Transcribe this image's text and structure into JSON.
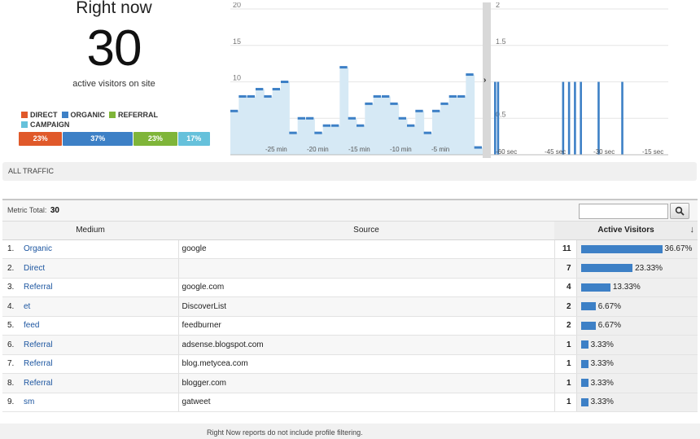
{
  "rightnow": {
    "title": "Right now",
    "count": "30",
    "subtitle": "active visitors on site",
    "legend": [
      {
        "label": "DIRECT",
        "color": "#e0592a"
      },
      {
        "label": "ORGANIC",
        "color": "#3d80c6"
      },
      {
        "label": "REFERRAL",
        "color": "#7fb539"
      },
      {
        "label": "CAMPAIGN",
        "color": "#66c1db"
      }
    ],
    "mix": [
      {
        "label": "23%",
        "value": 23,
        "color": "#e0592a"
      },
      {
        "label": "37%",
        "value": 37,
        "color": "#3d80c6"
      },
      {
        "label": "23%",
        "value": 23,
        "color": "#7fb539"
      },
      {
        "label": "17%",
        "value": 17,
        "color": "#66c1db"
      }
    ]
  },
  "chart_data": [
    {
      "type": "area",
      "y_ticks": [
        5,
        10,
        15,
        20
      ],
      "ylim": [
        0,
        20
      ],
      "x_ticks": [
        "-25 min",
        "-20 min",
        "-15 min",
        "-10 min",
        "-5 min"
      ],
      "values": [
        6,
        8,
        8,
        9,
        8,
        9,
        10,
        3,
        5,
        5,
        3,
        4,
        4,
        12,
        5,
        4,
        7,
        8,
        8,
        7,
        5,
        4,
        6,
        3,
        6,
        7,
        8,
        8,
        11,
        1
      ],
      "line_color": "#3d80c6",
      "fill_color": "#d6e9f5"
    },
    {
      "type": "bar",
      "y_ticks": [
        0.5,
        1.5,
        2
      ],
      "ylim": [
        0,
        2
      ],
      "x_ticks": [
        "-60 sec",
        "-45 sec",
        "-30 sec",
        "-15 sec"
      ],
      "values": [
        1,
        1,
        0,
        0,
        0,
        0,
        0,
        0,
        0,
        0,
        0,
        0,
        0,
        0,
        0,
        0,
        0,
        0,
        0,
        0,
        0,
        0,
        0,
        1,
        0,
        1,
        0,
        1,
        0,
        1,
        0,
        0,
        0,
        0,
        0,
        1,
        0,
        0,
        0,
        0,
        0,
        0,
        0,
        1,
        0,
        0,
        0,
        0,
        0,
        0,
        0,
        0,
        0,
        0,
        0,
        0,
        0,
        0,
        0,
        0
      ],
      "bar_color": "#3d80c6"
    }
  ],
  "all_traffic": "ALL TRAFFIC",
  "table": {
    "metric_label": "Metric Total:",
    "metric_total": "30",
    "search_placeholder": "",
    "headers": {
      "medium": "Medium",
      "source": "Source",
      "active": "Active Visitors"
    },
    "rows": [
      {
        "idx": "1.",
        "medium": "Organic",
        "source": "google",
        "count": "11",
        "pct": "36.67%",
        "share": 36.67
      },
      {
        "idx": "2.",
        "medium": "Direct",
        "source": "",
        "count": "7",
        "pct": "23.33%",
        "share": 23.33
      },
      {
        "idx": "3.",
        "medium": "Referral",
        "source": "google.com",
        "count": "4",
        "pct": "13.33%",
        "share": 13.33
      },
      {
        "idx": "4.",
        "medium": "et",
        "source": "DiscoverList",
        "count": "2",
        "pct": "6.67%",
        "share": 6.67
      },
      {
        "idx": "5.",
        "medium": "feed",
        "source": "feedburner",
        "count": "2",
        "pct": "6.67%",
        "share": 6.67
      },
      {
        "idx": "6.",
        "medium": "Referral",
        "source": "adsense.blogspot.com",
        "count": "1",
        "pct": "3.33%",
        "share": 3.33
      },
      {
        "idx": "7.",
        "medium": "Referral",
        "source": "blog.metycea.com",
        "count": "1",
        "pct": "3.33%",
        "share": 3.33
      },
      {
        "idx": "8.",
        "medium": "Referral",
        "source": "blogger.com",
        "count": "1",
        "pct": "3.33%",
        "share": 3.33
      },
      {
        "idx": "9.",
        "medium": "sm",
        "source": "gatweet",
        "count": "1",
        "pct": "3.33%",
        "share": 3.33
      }
    ]
  },
  "footer": "Right Now reports do not include profile filtering."
}
